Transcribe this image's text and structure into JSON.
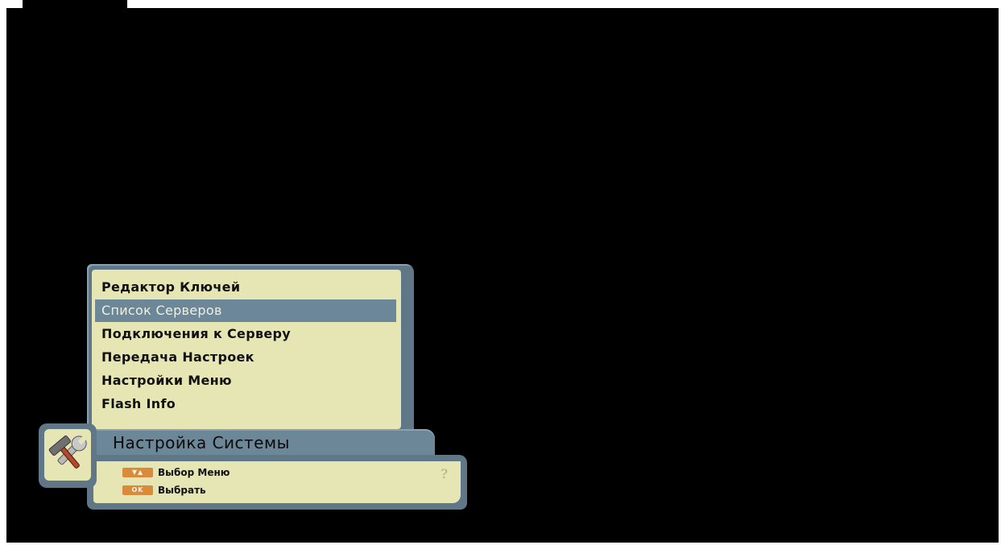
{
  "menu": {
    "items": [
      {
        "label": "Редактор Ключей",
        "selected": false
      },
      {
        "label": "Список Серверов",
        "selected": true
      },
      {
        "label": "Подключения к Серверу",
        "selected": false
      },
      {
        "label": "Передача Настроек",
        "selected": false
      },
      {
        "label": "Настройки Меню",
        "selected": false
      },
      {
        "label": "Flash Info",
        "selected": false
      }
    ]
  },
  "title": "Настройка Системы",
  "hints": [
    {
      "key": "▼▲",
      "label": "Выбор Меню"
    },
    {
      "key": "OK",
      "label": "Выбрать"
    }
  ],
  "icons": {
    "section": "tools-icon",
    "help": "help-icon"
  },
  "colors": {
    "panel_bg": "#e5e6b4",
    "frame": "#5f7787",
    "selection": "#6b8798",
    "key_badge": "#d98a3b"
  }
}
